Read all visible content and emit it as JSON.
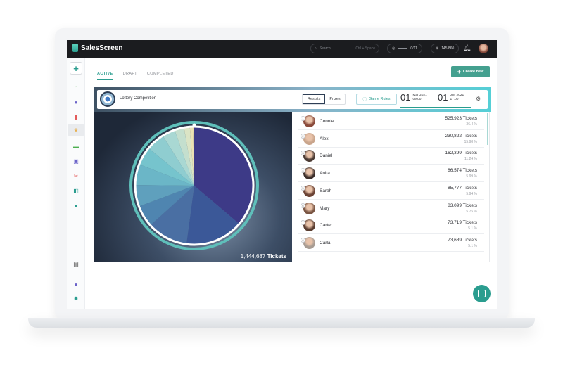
{
  "app": {
    "name": "SalesScreen"
  },
  "topbar": {
    "search_placeholder": "Search",
    "search_hint": "Ctrl + Space",
    "progress": "0/11",
    "points": "145,860",
    "icons": [
      "search-icon",
      "target-icon",
      "coin-icon",
      "bell-icon",
      "avatar"
    ]
  },
  "sidebar": {
    "icons": [
      "plus-icon",
      "home-icon",
      "globe-icon",
      "bar-chart-icon",
      "trophy-icon",
      "ticket-icon",
      "gift-icon",
      "scissors-icon",
      "cards-icon",
      "lightbulb-icon",
      "report-icon",
      "help-icon",
      "gear-icon"
    ]
  },
  "tabs": [
    {
      "label": "ACTIVE",
      "active": true
    },
    {
      "label": "DRAFT",
      "active": false
    },
    {
      "label": "COMPLETED",
      "active": false
    }
  ],
  "create_button": "Create new",
  "competition": {
    "title": "Lottery Competition",
    "view_results": "Results",
    "view_prizes": "Prizes",
    "rules": "Game Rules",
    "start": {
      "day": "01",
      "month_year": "Mar 2021",
      "time": "09:00"
    },
    "end": {
      "day": "01",
      "month_year": "Jun 2021",
      "time": "17:00"
    }
  },
  "total": {
    "value": "1,444,687",
    "label": "Tickets"
  },
  "participants": [
    {
      "rank": "1",
      "name": "Connie",
      "tickets": "525,923 Tickets",
      "pct": "36.4 %"
    },
    {
      "rank": "2",
      "name": "Alex",
      "tickets": "230,822 Tickets",
      "pct": "15.98 %"
    },
    {
      "rank": "3",
      "name": "Daniel",
      "tickets": "162,399 Tickets",
      "pct": "11.24 %"
    },
    {
      "rank": "4",
      "name": "Anita",
      "tickets": "86,574 Tickets",
      "pct": "5.99 %"
    },
    {
      "rank": "5",
      "name": "Sarah",
      "tickets": "85,777 Tickets",
      "pct": "5.94 %"
    },
    {
      "rank": "6",
      "name": "Mary",
      "tickets": "83,099 Tickets",
      "pct": "5.75 %"
    },
    {
      "rank": "7",
      "name": "Carter",
      "tickets": "73,719 Tickets",
      "pct": "5.1 %"
    },
    {
      "rank": "8",
      "name": "Carla",
      "tickets": "73,689 Tickets",
      "pct": "5.1 %"
    }
  ],
  "wheel_shares": [
    36.4,
    15.98,
    11.24,
    5.99,
    5.94,
    5.75,
    5.1,
    5.1,
    3.6,
    2.6,
    1.6,
    0.9,
    0.3
  ],
  "wheel_colors": [
    "#3d3a87",
    "#3b5898",
    "#4a6fa3",
    "#4f85b0",
    "#5fa0bd",
    "#6bb6c7",
    "#76c4cd",
    "#8fcdd0",
    "#a9d8d3",
    "#c4dfce",
    "#dbe4c5",
    "#eae1b4",
    "#f1dea3"
  ],
  "avatar_colors": [
    "#8a4b3c",
    "#c9a58c",
    "#4a3a33",
    "#3c2e2a",
    "#6b4335",
    "#7a5644",
    "#5a3d30",
    "#a89c93"
  ]
}
